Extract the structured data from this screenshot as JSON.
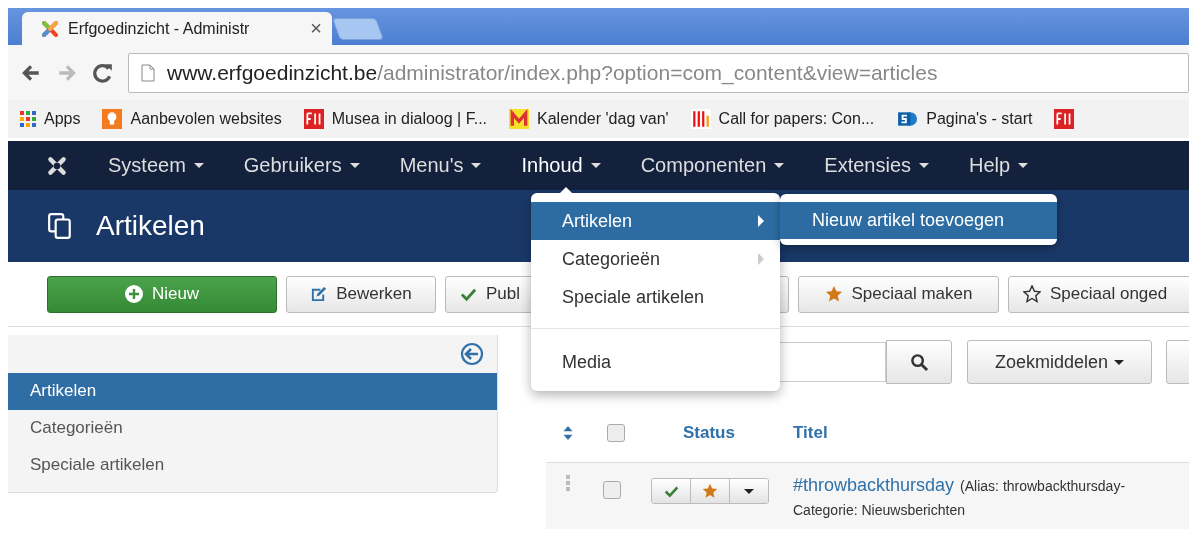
{
  "browser": {
    "tab": {
      "title": "Erfgoedinzicht - Administr",
      "close": "×"
    },
    "address": {
      "host": "www.erfgoedinzicht.be",
      "path": "/administrator/index.php?option=com_content&view=articles"
    },
    "bookmarks": [
      {
        "kind": "apps",
        "label": "Apps"
      },
      {
        "kind": "bulb",
        "label": "Aanbevolen websites"
      },
      {
        "kind": "faro",
        "label": "Musea in dialoog | F..."
      },
      {
        "kind": "m",
        "label": "Kalender 'dag van'"
      },
      {
        "kind": "bars",
        "label": "Call for papers: Con..."
      },
      {
        "kind": "sharepoint",
        "label": "Pagina's - start"
      },
      {
        "kind": "faro"
      }
    ]
  },
  "nav": {
    "items": [
      {
        "label": "Systeem",
        "selected": false
      },
      {
        "label": "Gebruikers",
        "selected": false
      },
      {
        "label": "Menu's",
        "selected": false
      },
      {
        "label": "Inhoud",
        "selected": true
      },
      {
        "label": "Componenten",
        "selected": false
      },
      {
        "label": "Extensies",
        "selected": false
      },
      {
        "label": "Help",
        "selected": false
      }
    ]
  },
  "menu": {
    "items": [
      {
        "kind": "item",
        "label": "Artikelen",
        "selected": true,
        "submenu": true
      },
      {
        "kind": "item",
        "label": "Categorieën",
        "selected": false,
        "submenu": true
      },
      {
        "kind": "item",
        "label": "Speciale artikelen",
        "selected": false,
        "submenu": false
      },
      {
        "kind": "divider"
      },
      {
        "kind": "item",
        "label": "Media",
        "selected": false,
        "submenu": false
      }
    ],
    "submenu": {
      "items": [
        {
          "label": "Nieuw artikel toevoegen",
          "selected": true
        }
      ]
    }
  },
  "header": {
    "title": "Artikelen"
  },
  "toolbar": {
    "buttons": [
      {
        "kind": "primary",
        "label": "Nieuw"
      },
      {
        "kind": "default",
        "label": "Bewerken"
      },
      {
        "kind": "default",
        "label": "Publ"
      },
      {
        "kind": "default",
        "label": "Speciaal maken"
      },
      {
        "kind": "default",
        "label": "Speciaal onged"
      }
    ]
  },
  "sidebar": {
    "items": [
      {
        "label": "Artikelen",
        "selected": true
      },
      {
        "label": "Categorieën",
        "selected": false
      },
      {
        "label": "Speciale artikelen",
        "selected": false
      }
    ]
  },
  "filters": {
    "search_tools": "Zoekmiddelen"
  },
  "table": {
    "select_all": {
      "checked": false
    },
    "columns": [
      "Status",
      "Titel"
    ],
    "rows": [
      {
        "checked": false,
        "published": true,
        "featured": true,
        "title": "#throwbackthursday",
        "alias": "(Alias: throwbackthursday-",
        "category": "Categorie: Nieuwsberichten"
      }
    ]
  }
}
